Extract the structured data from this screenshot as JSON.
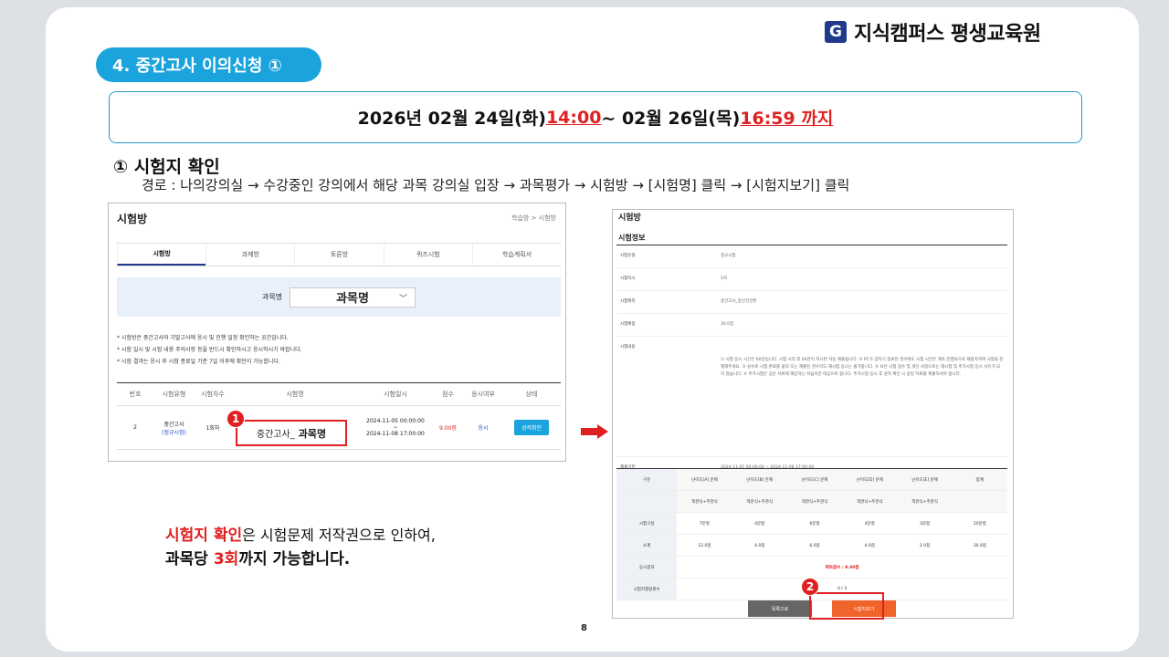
{
  "logo": {
    "letter": "G",
    "text": "지식캠퍼스 평생교육원",
    "color": "#1f3a8a"
  },
  "section": {
    "title": "4. 중간고사 이의신청 ①",
    "color": "#1aa3dc"
  },
  "period": {
    "prefix": "2026년 02월 24일(화) ",
    "start_time": "14:00",
    "middle": " ~ 02월 26일(목) ",
    "end_time": "16:59 까지",
    "highlight_color": "#e02020"
  },
  "step": {
    "title": "① 시험지 확인",
    "path": "경로 : 나의강의실 → 수강중인 강의에서 해당 과목 강의실 입장 → 과목평가 → 시험방 →  [시험명] 클릭 → [시험지보기] 클릭"
  },
  "left_panel": {
    "title": "시험방",
    "breadcrumb": "학습방 > 시험방",
    "tabs": [
      "시험방",
      "과제방",
      "토론방",
      "퀴즈시험",
      "학습계획서"
    ],
    "search_label": "과목명",
    "search_value": "과목명",
    "notes": [
      "* 시험방은 중간고사와 기말고사에 응시 및 진행 일정 확인하는 공간입니다.",
      "* 시험 일시 및 시험 내용 주의사항 등을 반드시 확인하시고 응시하시기 바랍니다.",
      "* 시험 결과는 응시 후 시험 종료일 기준 7일 이후에 확인이 가능합니다."
    ],
    "headers": [
      "번호",
      "시험유형",
      "시험차수",
      "시험명",
      "시험일시",
      "점수",
      "응시여부",
      "상태"
    ],
    "row": {
      "no": "2",
      "type": "중간고사",
      "type_sub": "(정규시험)",
      "round": "1회차",
      "name_prefix": "중간고사_",
      "name_subject": "과목명",
      "date_start": "2024-11-05 00:00:00",
      "date_sep": "~",
      "date_end": "2024-11-08 17:00:00",
      "score": "9.00점",
      "taken": "응시",
      "status_button": "성적확인"
    }
  },
  "badges": {
    "one": "1",
    "two": "2"
  },
  "bottom_note": {
    "highlight": "시험지 확인",
    "rest1": "은 시험문제 저작권으로 인하여,",
    "line2_a": "과목당 ",
    "line2_num": "3회",
    "line2_b": "까지 가능합니다."
  },
  "page_number": "8",
  "right_panel": {
    "title": "시험방",
    "subtitle": "시험정보",
    "info": [
      {
        "k": "시험유형",
        "v": "정규시험"
      },
      {
        "k": "시험차시",
        "v": "1차"
      },
      {
        "k": "시험제목",
        "v": "중간고사_정신건강론"
      },
      {
        "k": "시험배점",
        "v": "30.0점"
      },
      {
        "k": "시험내용",
        "v": "① 시험 응시 시간은 60분입니다. 시험 시작 후 60분이 지나면 자동 제출됩니다. ② PC가 갑자기 종료된 경우에도 시험 시간은 계속 진행되므로 재접속하여 시험을 진행해주세요. ③ 실수로 시험 완료를 클릭 또는 제출된 경우라도 재시험 응시는 불가합니다. ④ 보안 시험 점수 및 개인 사정으로는 재시험 및 추가시험 응시 사유가 되지 않습니다. ⑤ 추가시험은 공문 서류에 해당하는 학습자만 대상으로 합니다. 추가시험 응시 후 성적 확인 시 증빙 자료를 제출하셔야 합니다."
      },
      {
        "k": "제출기한",
        "v": "2024-11-05 00:00:00 ~ 2024-11-08 17:00:00"
      }
    ],
    "grid_headers": [
      "구분",
      "난이도[A] 문제",
      "난이도[B] 문제",
      "난이도[C] 문제",
      "난이도[D] 문제",
      "난이도[E] 문제",
      "합계"
    ],
    "grid_sub": [
      "",
      "객관식+주관식",
      "객관식+주관식",
      "객관식+주관식",
      "객관식+주관식",
      "객관식+주관식",
      ""
    ],
    "grid_rows": [
      {
        "label": "시험구성",
        "vals": [
          "7문항",
          "4문항",
          "6문항",
          "4문항",
          "3문항",
          "",
          "20문항"
        ]
      },
      {
        "label": "소계",
        "vals": [
          "12.0점",
          "4.0점",
          "6.0점",
          "4.0점",
          "2.0점",
          "",
          "30.0점"
        ]
      }
    ],
    "result_label": "응시결과",
    "result_value": "획득점수 : 9.00점",
    "count_label": "시험지열람횟수",
    "count_value": "0 / 3",
    "btn_list": "목록으로",
    "btn_view": "시험지보기"
  }
}
